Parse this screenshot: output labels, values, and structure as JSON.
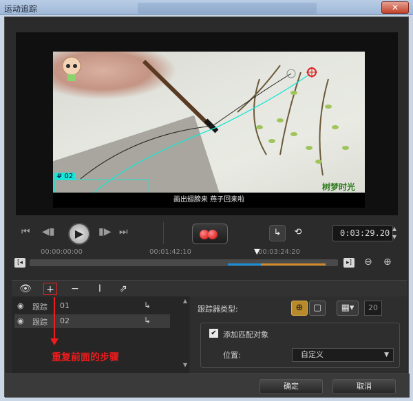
{
  "window": {
    "title": "运动追踪",
    "close_label": "✕"
  },
  "preview": {
    "track_label": "# 02",
    "caption": "画出翅膀来   燕子回来啦",
    "watermark": "树梦时光"
  },
  "controls": {
    "timecode": "0:03:29.20",
    "icons": [
      "skip-to-start-icon",
      "step-back-icon",
      "play-icon",
      "step-forward-icon",
      "skip-to-end-icon",
      "record-tracking-icon",
      "path-icon",
      "history-icon"
    ]
  },
  "timeline": {
    "ticks": [
      "00:00:00:00",
      "00:01:42:10",
      "00:03:24:20"
    ],
    "playhead_fraction": 0.76
  },
  "tracker_list": {
    "rows": [
      {
        "name": "跟踪",
        "num": "01",
        "selected": false
      },
      {
        "name": "跟踪",
        "num": "02",
        "selected": true
      }
    ]
  },
  "annotation": {
    "text": "重复前面的步骤",
    "color": "#ee1c1c"
  },
  "settings": {
    "tracker_type_label": "跟踪器类型:",
    "number_value": "20",
    "add_match_label": "添加匹配对象",
    "add_match_checked": true,
    "position_label": "位置:",
    "position_value": "自定义"
  },
  "footer": {
    "ok_label": "确定",
    "cancel_label": "取消"
  }
}
